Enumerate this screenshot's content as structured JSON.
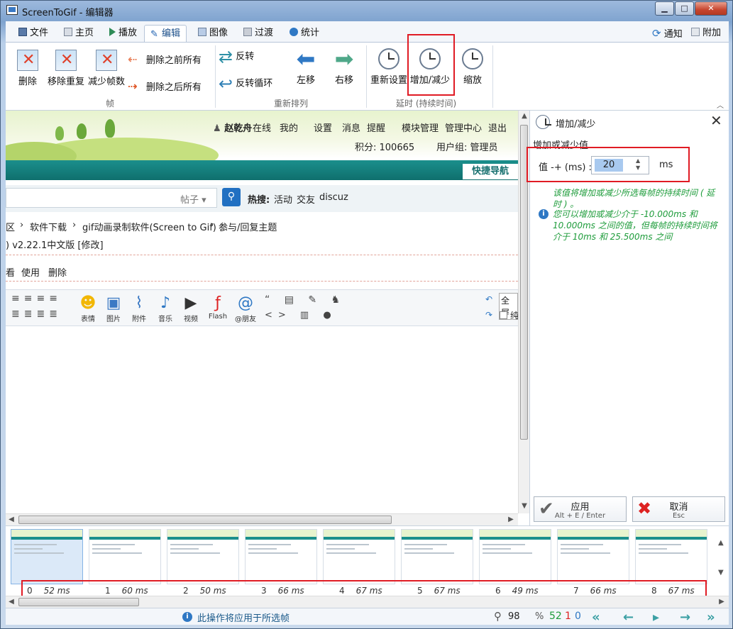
{
  "window": {
    "title": "ScreenToGif - 编辑器",
    "minimize": "▁",
    "maximize": "□",
    "close": "✕"
  },
  "tabs": [
    {
      "label": "文件",
      "icon": "save-icon"
    },
    {
      "label": "主页",
      "icon": "home-icon"
    },
    {
      "label": "播放",
      "icon": "play-icon"
    },
    {
      "label": "编辑",
      "icon": "pencil-icon",
      "active": true
    },
    {
      "label": "图像",
      "icon": "image-icon"
    },
    {
      "label": "过渡",
      "icon": "transition-icon"
    },
    {
      "label": "统计",
      "icon": "info-icon"
    }
  ],
  "top_right": {
    "notify": "通知",
    "attach": "附加"
  },
  "ribbon": {
    "frames_group": {
      "label": "帧",
      "delete": "删除",
      "remove_duplicates": "移除重复",
      "reduce_frames": "减少帧数",
      "delete_before": "删除之前所有",
      "delete_after": "删除之后所有"
    },
    "reorder_group": {
      "label": "重新排列",
      "reverse": "反转",
      "yoyo": "反转循环",
      "move_left": "左移",
      "move_right": "右移"
    },
    "delay_group": {
      "label": "延时 (持续时间)",
      "override": "重新设置",
      "increase_decrease": "增加/减少",
      "scale": "缩放"
    }
  },
  "webpage": {
    "user": "赵乾舟",
    "online": "在线",
    "nav": [
      "我的",
      "设置",
      "消息",
      "提醒",
      "模块管理",
      "管理中心",
      "退出"
    ],
    "points": "积分: 100665",
    "group": "用户组: 管理员",
    "quick_nav": "快捷导航",
    "search_scope": "帖子",
    "hot_label": "热搜:",
    "hot_terms": [
      "活动",
      "交友",
      "discuz"
    ],
    "breadcrumb": [
      "区",
      "软件下载",
      "gif动画录制软件(Screen to Gif) ...",
      "参与/回复主题"
    ],
    "version_line": ") v2.22.1中文版 [修改]",
    "actions": [
      "看",
      "使用",
      "删除"
    ],
    "editor_tools": [
      "表情",
      "图片",
      "附件",
      "音乐",
      "视频",
      "Flash",
      "@朋友"
    ],
    "fullscreen": "全屏",
    "pure": "纯"
  },
  "panel": {
    "title": "增加/减少",
    "subtitle": "增加或减少值",
    "field_label": "值 -+ (ms) :",
    "field_value": "20",
    "unit": "ms",
    "note1": "该值将增加或减少所选每帧的持续时间 ( 延时 ) 。",
    "note2": "您可以增加或减少介于 -10.000ms 和 10.000ms 之间的值，但每帧的持续时间将介于 10ms 和 25.500ms 之间",
    "apply": "应用",
    "apply_shortcut": "Alt + E / Enter",
    "cancel": "取消",
    "cancel_shortcut": "Esc"
  },
  "frames": [
    {
      "index": "0",
      "ms": "52 ms"
    },
    {
      "index": "1",
      "ms": "60 ms"
    },
    {
      "index": "2",
      "ms": "50 ms"
    },
    {
      "index": "3",
      "ms": "66 ms"
    },
    {
      "index": "4",
      "ms": "67 ms"
    },
    {
      "index": "5",
      "ms": "67 ms"
    },
    {
      "index": "6",
      "ms": "49 ms"
    },
    {
      "index": "7",
      "ms": "66 ms"
    },
    {
      "index": "8",
      "ms": "67 ms"
    }
  ],
  "status": {
    "message": "此操作将应用于所选帧",
    "zoom": "98",
    "percent": "%",
    "total": "52",
    "selected": "1",
    "current": "0"
  }
}
